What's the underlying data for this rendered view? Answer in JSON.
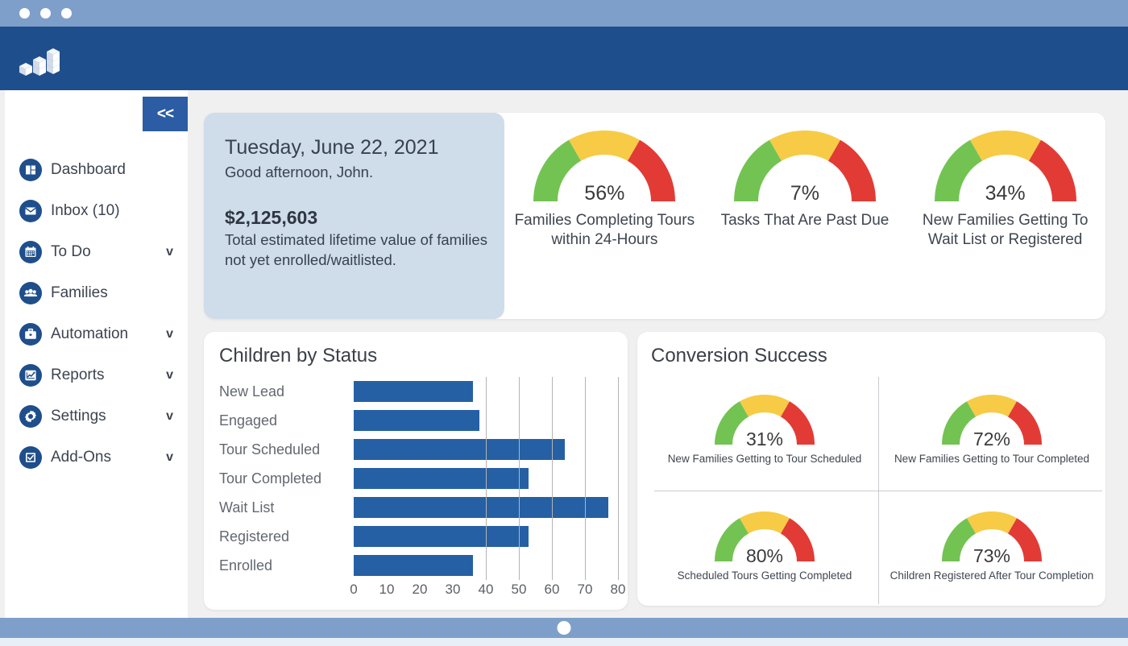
{
  "window": {
    "dots": [
      "close-dot",
      "minimize-dot",
      "maximize-dot"
    ],
    "chrome_color": "#7e9fc9",
    "brand_color": "#1f4e8c"
  },
  "sidebar": {
    "collapse_label": "<<",
    "items": [
      {
        "label": "Dashboard",
        "icon": "dashboard-icon",
        "caret": ""
      },
      {
        "label": "Inbox (10)",
        "icon": "envelope-icon",
        "caret": ""
      },
      {
        "label": "To Do",
        "icon": "calendar-icon",
        "caret": "v"
      },
      {
        "label": "Families",
        "icon": "people-icon",
        "caret": ""
      },
      {
        "label": "Automation",
        "icon": "briefcase-icon",
        "caret": "v"
      },
      {
        "label": "Reports",
        "icon": "line-chart-icon",
        "caret": "v"
      },
      {
        "label": "Settings",
        "icon": "gear-icon",
        "caret": "v"
      },
      {
        "label": "Add-Ons",
        "icon": "checkbox-icon",
        "caret": "v"
      }
    ]
  },
  "welcome": {
    "date": "Tuesday, June 22, 2021",
    "greeting": "Good afternoon, John.",
    "amount": "$2,125,603",
    "description": "Total estimated lifetime value of families not yet enrolled/waitlisted.",
    "background": "#cfdcea"
  },
  "top_gauges": [
    {
      "value": "56%",
      "percent": 56,
      "caption": "Families Completing Tours within 24-Hours"
    },
    {
      "value": "7%",
      "percent": 7,
      "caption": "Tasks That Are Past Due"
    },
    {
      "value": "34%",
      "percent": 34,
      "caption": "New Families Getting To Wait List or Registered"
    }
  ],
  "children_by_status": {
    "title": "Children by Status"
  },
  "conversion": {
    "title": "Conversion Success",
    "gauges": [
      {
        "value": "31%",
        "percent": 31,
        "caption": "New Families Getting to Tour Scheduled"
      },
      {
        "value": "72%",
        "percent": 72,
        "caption": "New Families Getting to Tour Completed"
      },
      {
        "value": "80%",
        "percent": 80,
        "caption": "Scheduled Tours Getting Completed"
      },
      {
        "value": "73%",
        "percent": 73,
        "caption": "Children Registered After Tour Completion"
      }
    ]
  },
  "colors": {
    "gauge_green": "#73c353",
    "gauge_yellow": "#f7cb45",
    "gauge_red": "#e23b36",
    "bar_blue": "#2560a4",
    "accent": "#2b5ca4"
  },
  "chart_data": {
    "type": "bar",
    "orientation": "horizontal",
    "title": "Children by Status",
    "categories": [
      "New Lead",
      "Engaged",
      "Tour Scheduled",
      "Tour Completed",
      "Wait List",
      "Registered",
      "Enrolled"
    ],
    "values": [
      36,
      38,
      64,
      53,
      77,
      53,
      36
    ],
    "xlabel": "",
    "ylabel": "",
    "xlim": [
      0,
      80
    ],
    "xticks": [
      0,
      10,
      20,
      30,
      40,
      50,
      60,
      70,
      80
    ],
    "gridlines": [
      40,
      50,
      60,
      70,
      80
    ],
    "grid": true,
    "legend": false,
    "series_color": "#2560a4"
  }
}
